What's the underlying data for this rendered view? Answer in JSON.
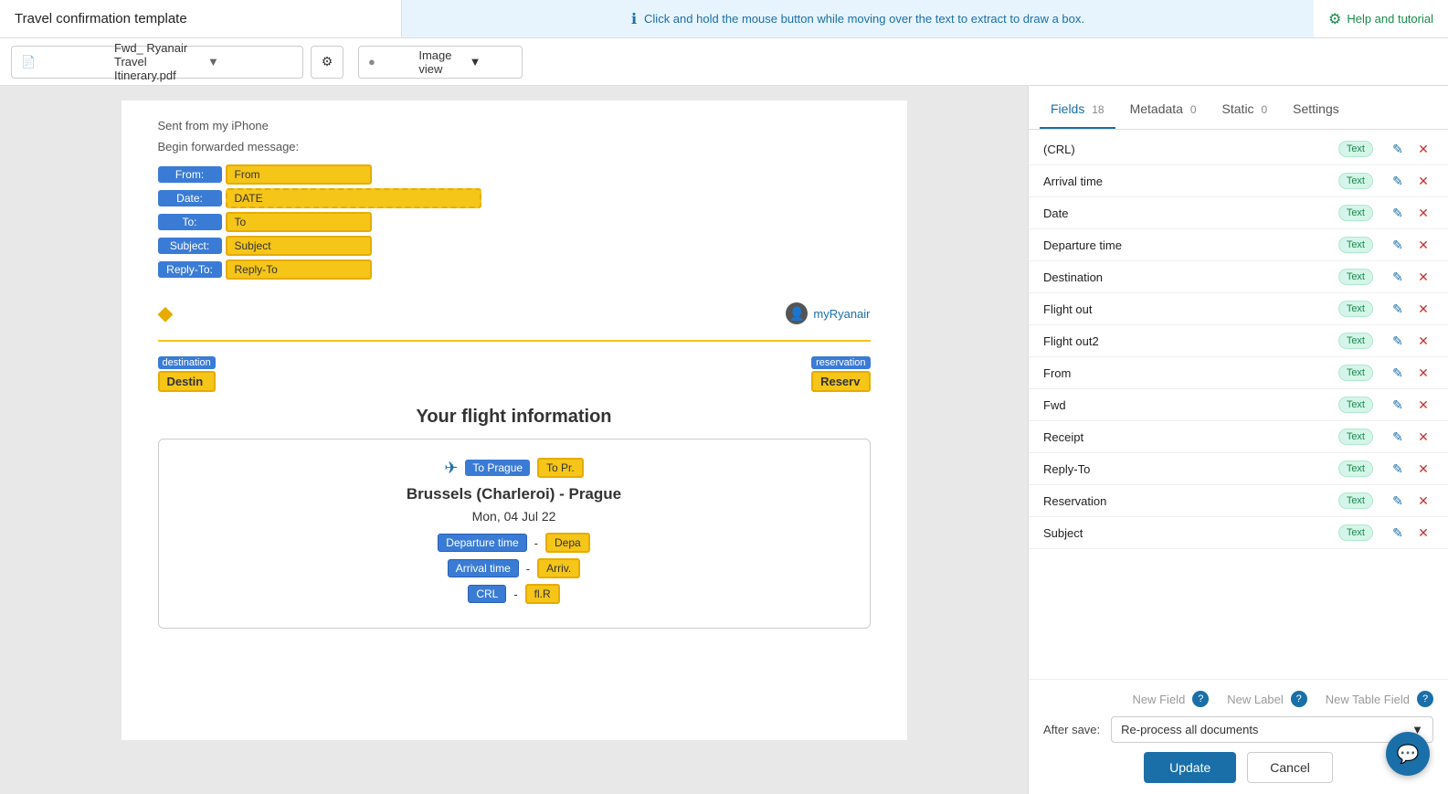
{
  "topbar": {
    "title": "Travel confirmation template",
    "info": "Click and hold the mouse button while moving over the text to extract to draw a box.",
    "help_label": "Help and tutorial"
  },
  "secondbar": {
    "filename": "Fwd_ Ryanair Travel Itinerary.pdf",
    "view_label": "Image view"
  },
  "document": {
    "header_line1": "Sent from my iPhone",
    "header_line2": "Begin forwarded message:",
    "from_label": "From:",
    "from_value": "From",
    "date_label": "Date:",
    "date_value": "DATE",
    "to_label": "To:",
    "to_value": "To",
    "subject_label": "Subject:",
    "subject_value": "Subject",
    "reply_to_label": "Reply-To:",
    "reply_to_value": "Reply-To",
    "dest_label": "destination",
    "dest_value": "Destin",
    "reservation_label": "reservation",
    "reservation_value": "Reserv",
    "flight_title": "Your flight information",
    "to_prague_label": "To Prague",
    "to_prague_value": "To Pr.",
    "route": "Brussels (Charleroi) - Prague",
    "date": "Mon, 04 Jul 22",
    "departure_label": "Departure time",
    "departure_value": "Depa",
    "arrival_label": "Arrival time",
    "arrival_value": "Arriv.",
    "crl_label": "CRL",
    "crl_value": "fl.R",
    "myryanair": "myRyanair"
  },
  "panel": {
    "tabs": [
      {
        "label": "Fields",
        "count": "18",
        "active": true
      },
      {
        "label": "Metadata",
        "count": "0",
        "active": false
      },
      {
        "label": "Static",
        "count": "0",
        "active": false
      },
      {
        "label": "Settings",
        "count": null,
        "active": false
      }
    ],
    "fields": [
      {
        "name": "(CRL)",
        "type": "Text"
      },
      {
        "name": "Arrival time",
        "type": "Text"
      },
      {
        "name": "Date",
        "type": "Text"
      },
      {
        "name": "Departure time",
        "type": "Text"
      },
      {
        "name": "Destination",
        "type": "Text"
      },
      {
        "name": "Flight out",
        "type": "Text"
      },
      {
        "name": "Flight out2",
        "type": "Text"
      },
      {
        "name": "From",
        "type": "Text"
      },
      {
        "name": "Fwd",
        "type": "Text"
      },
      {
        "name": "Receipt",
        "type": "Text"
      },
      {
        "name": "Reply-To",
        "type": "Text"
      },
      {
        "name": "Reservation",
        "type": "Text"
      },
      {
        "name": "Subject",
        "type": "Text"
      }
    ],
    "new_field": "New Field",
    "new_label": "New Label",
    "new_table_field": "New Table Field",
    "after_save_label": "After save:",
    "after_save_value": "Re-process all documents",
    "update_btn": "Update",
    "cancel_btn": "Cancel"
  }
}
